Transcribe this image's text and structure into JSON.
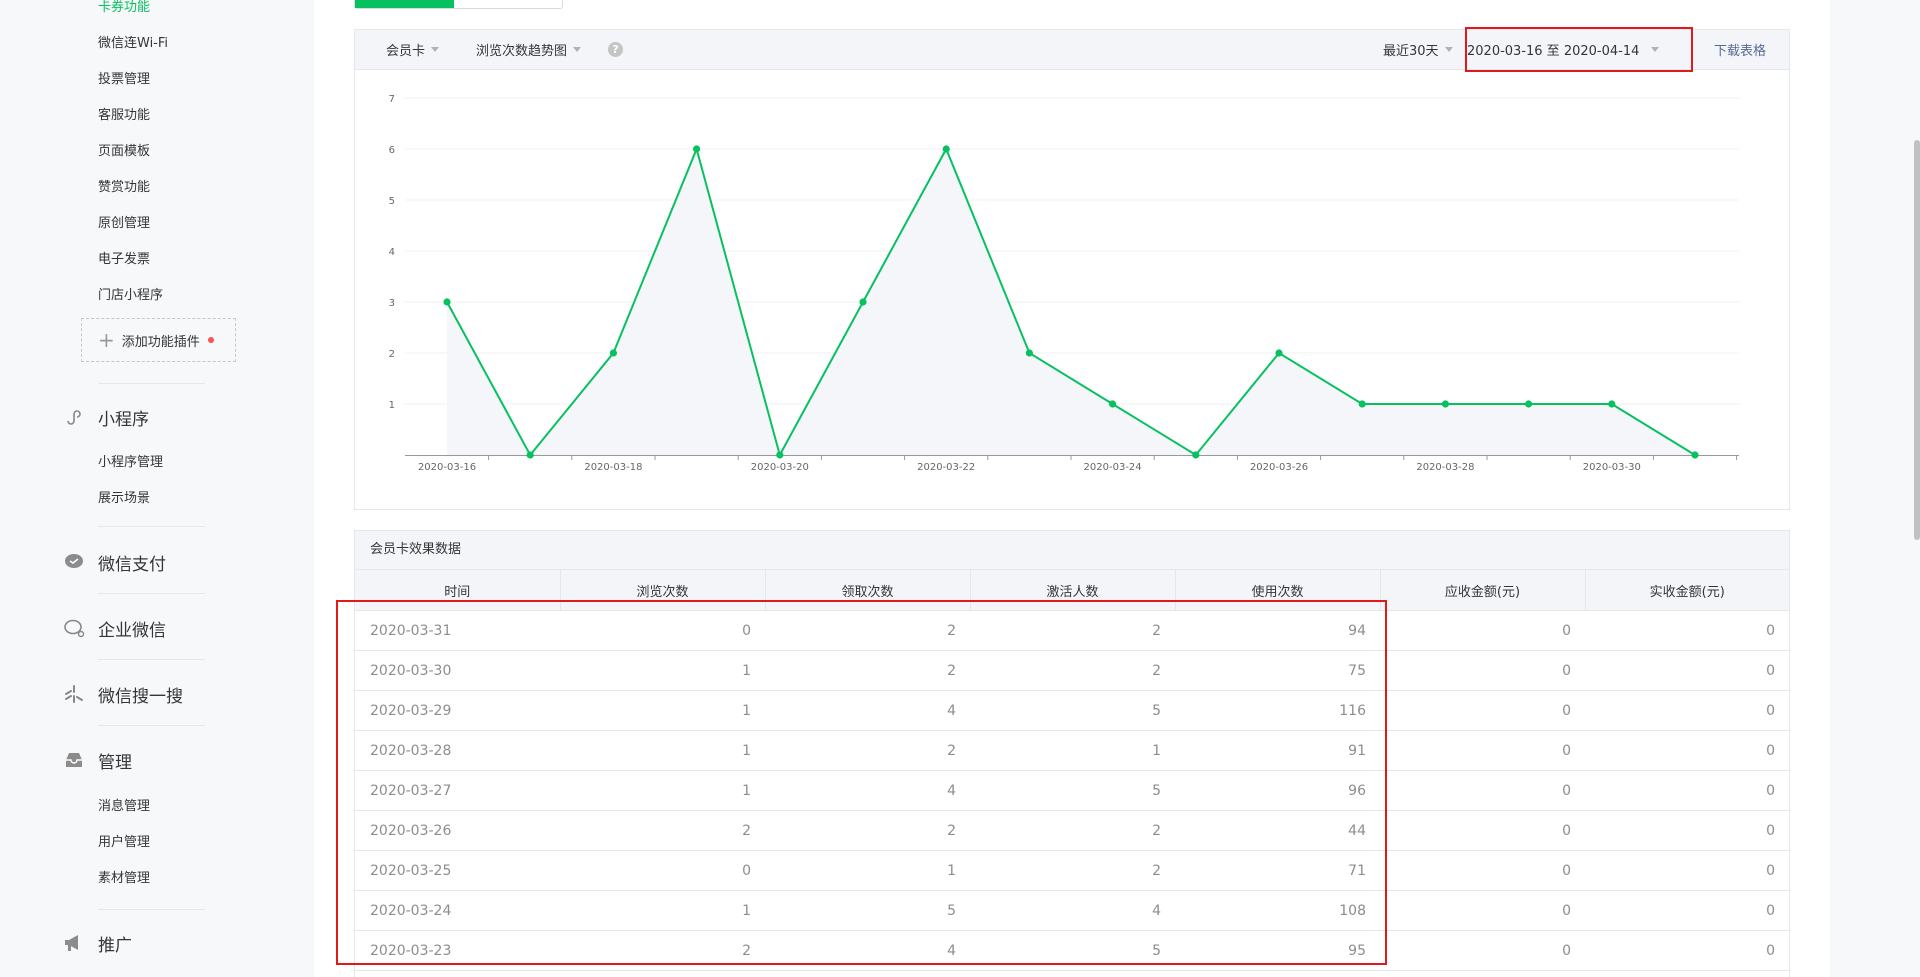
{
  "sidebar": {
    "plugin_items": [
      "卡券功能",
      "微信连Wi-Fi",
      "投票管理",
      "客服功能",
      "页面模板",
      "赞赏功能",
      "原创管理",
      "电子发票",
      "门店小程序"
    ],
    "add_plugin": "添加功能插件",
    "sections": [
      {
        "icon": "mini-program-icon",
        "title": "小程序",
        "items": [
          "小程序管理",
          "展示场景"
        ]
      },
      {
        "icon": "wechat-pay-icon",
        "title": "微信支付",
        "items": []
      },
      {
        "icon": "enterprise-wechat-icon",
        "title": "企业微信",
        "items": []
      },
      {
        "icon": "wechat-search-icon",
        "title": "微信搜一搜",
        "items": []
      },
      {
        "icon": "manage-inbox-icon",
        "title": "管理",
        "items": [
          "消息管理",
          "用户管理",
          "素材管理"
        ]
      },
      {
        "icon": "megaphone-icon",
        "title": "推广",
        "items": []
      }
    ]
  },
  "toolbar": {
    "card_select": "会员卡",
    "chart_select": "浏览次数趋势图",
    "help": "?",
    "period_select": "最近30天",
    "date_range": "2020-03-16 至 2020-04-14",
    "download": "下载表格"
  },
  "chart_data": {
    "type": "area",
    "x": [
      "2020-03-16",
      "2020-03-17",
      "2020-03-18",
      "2020-03-19",
      "2020-03-20",
      "2020-03-21",
      "2020-03-22",
      "2020-03-23",
      "2020-03-24",
      "2020-03-25",
      "2020-03-26",
      "2020-03-27",
      "2020-03-28",
      "2020-03-29",
      "2020-03-30",
      "2020-03-31"
    ],
    "values": [
      3,
      0,
      2,
      6,
      0,
      3,
      6,
      2,
      1,
      0,
      2,
      1,
      1,
      1,
      1,
      0
    ],
    "x_tick_labels": [
      "2020-03-16",
      "2020-03-18",
      "2020-03-20",
      "2020-03-22",
      "2020-03-24",
      "2020-03-26",
      "2020-03-28",
      "2020-03-30"
    ],
    "y_ticks": [
      1,
      2,
      3,
      4,
      5,
      6,
      7
    ],
    "ylim": [
      0,
      7
    ],
    "grid": true,
    "legend": "none",
    "line_color": "#07c160",
    "fill_color": "#f4f6f9"
  },
  "table": {
    "title": "会员卡效果数据",
    "headers": [
      "时间",
      "浏览次数",
      "领取次数",
      "激活人数",
      "使用次数",
      "应收金额(元)",
      "实收金额(元)"
    ],
    "rows": [
      [
        "2020-03-31",
        "0",
        "2",
        "2",
        "94",
        "0",
        "0"
      ],
      [
        "2020-03-30",
        "1",
        "2",
        "2",
        "75",
        "0",
        "0"
      ],
      [
        "2020-03-29",
        "1",
        "4",
        "5",
        "116",
        "0",
        "0"
      ],
      [
        "2020-03-28",
        "1",
        "2",
        "1",
        "91",
        "0",
        "0"
      ],
      [
        "2020-03-27",
        "1",
        "4",
        "5",
        "96",
        "0",
        "0"
      ],
      [
        "2020-03-26",
        "2",
        "2",
        "2",
        "44",
        "0",
        "0"
      ],
      [
        "2020-03-25",
        "0",
        "1",
        "2",
        "71",
        "0",
        "0"
      ],
      [
        "2020-03-24",
        "1",
        "5",
        "4",
        "108",
        "0",
        "0"
      ],
      [
        "2020-03-23",
        "2",
        "4",
        "5",
        "95",
        "0",
        "0"
      ]
    ]
  },
  "colors": {
    "accent": "#07c160",
    "link": "#576b95",
    "highlight": "#e0191b"
  }
}
